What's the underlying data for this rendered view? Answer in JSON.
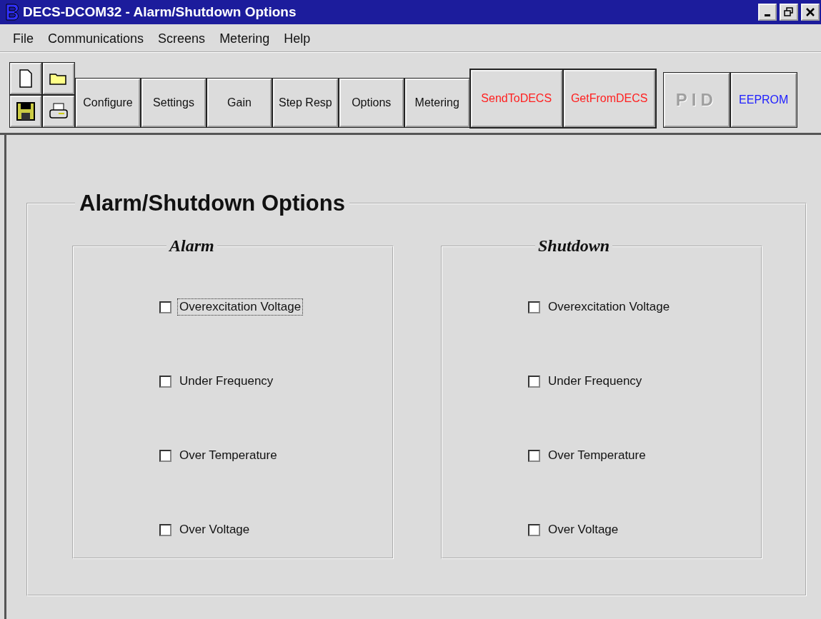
{
  "window": {
    "title": "DECS-DCOM32 - Alarm/Shutdown Options"
  },
  "menu": [
    "File",
    "Communications",
    "Screens",
    "Metering",
    "Help"
  ],
  "toolbar": {
    "buttons": [
      {
        "label": "Configure",
        "kind": "normal",
        "disabled": false
      },
      {
        "label": "Settings",
        "kind": "normal",
        "disabled": false
      },
      {
        "label": "Gain",
        "kind": "normal",
        "disabled": false
      },
      {
        "label": "Step Resp",
        "kind": "normal",
        "disabled": false
      },
      {
        "label": "Options",
        "kind": "normal",
        "disabled": false
      },
      {
        "label": "Metering",
        "kind": "normal",
        "disabled": false
      },
      {
        "label": "SendToDECS",
        "kind": "transfer",
        "disabled": false
      },
      {
        "label": "GetFromDECS",
        "kind": "transfer",
        "disabled": false
      },
      {
        "label": "PID",
        "kind": "special",
        "disabled": true
      },
      {
        "label": "EEPROM",
        "kind": "memory",
        "disabled": false
      }
    ]
  },
  "panel": {
    "title": "Alarm/Shutdown Options",
    "groups": [
      {
        "title": "Alarm",
        "options": [
          {
            "label": "Overexcitation Voltage",
            "checked": false,
            "focused": true
          },
          {
            "label": "Under Frequency",
            "checked": false,
            "focused": false
          },
          {
            "label": "Over Temperature",
            "checked": false,
            "focused": false
          },
          {
            "label": "Over Voltage",
            "checked": false,
            "focused": false
          }
        ]
      },
      {
        "title": "Shutdown",
        "options": [
          {
            "label": "Overexcitation Voltage",
            "checked": false,
            "focused": false
          },
          {
            "label": "Under Frequency",
            "checked": false,
            "focused": false
          },
          {
            "label": "Over Temperature",
            "checked": false,
            "focused": false
          },
          {
            "label": "Over Voltage",
            "checked": false,
            "focused": false
          }
        ]
      }
    ]
  }
}
